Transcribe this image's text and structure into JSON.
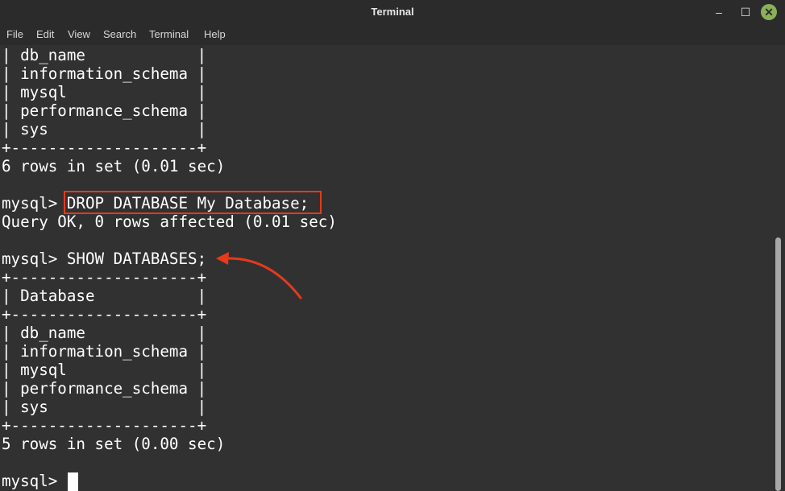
{
  "window": {
    "title": "Terminal"
  },
  "controls": {
    "minimize": "–",
    "maximize": "☐",
    "close": "✕"
  },
  "menu": [
    "File",
    "Edit",
    "View",
    "Search",
    "Terminal",
    "Help"
  ],
  "terminal": {
    "lines": [
      "| db_name            |",
      "| information_schema |",
      "| mysql              |",
      "| performance_schema |",
      "| sys                |",
      "+--------------------+",
      "6 rows in set (0.01 sec)",
      "",
      "mysql> DROP DATABASE My Database;",
      "Query OK, 0 rows affected (0.01 sec)",
      "",
      "mysql> SHOW DATABASES;",
      "+--------------------+",
      "| Database           |",
      "+--------------------+",
      "| db_name            |",
      "| information_schema |",
      "| mysql              |",
      "| performance_schema |",
      "| sys                |",
      "+--------------------+",
      "5 rows in set (0.00 sec)",
      "",
      "mysql> "
    ]
  },
  "annotations": {
    "highlight_color": "#e63a1b"
  }
}
